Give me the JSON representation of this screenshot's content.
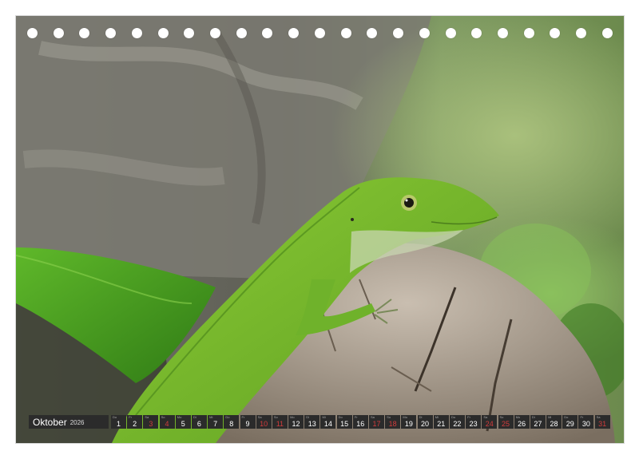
{
  "calendar": {
    "month": "Oktober",
    "year": "2026",
    "days": [
      {
        "n": "1",
        "wd": "Do",
        "weekend": false
      },
      {
        "n": "2",
        "wd": "Fr",
        "weekend": false
      },
      {
        "n": "3",
        "wd": "Sa",
        "weekend": true
      },
      {
        "n": "4",
        "wd": "So",
        "weekend": true
      },
      {
        "n": "5",
        "wd": "Mo",
        "weekend": false
      },
      {
        "n": "6",
        "wd": "Di",
        "weekend": false
      },
      {
        "n": "7",
        "wd": "Mi",
        "weekend": false
      },
      {
        "n": "8",
        "wd": "Do",
        "weekend": false
      },
      {
        "n": "9",
        "wd": "Fr",
        "weekend": false
      },
      {
        "n": "10",
        "wd": "Sa",
        "weekend": true
      },
      {
        "n": "11",
        "wd": "So",
        "weekend": true
      },
      {
        "n": "12",
        "wd": "Mo",
        "weekend": false
      },
      {
        "n": "13",
        "wd": "Di",
        "weekend": false
      },
      {
        "n": "14",
        "wd": "Mi",
        "weekend": false
      },
      {
        "n": "15",
        "wd": "Do",
        "weekend": false
      },
      {
        "n": "16",
        "wd": "Fr",
        "weekend": false
      },
      {
        "n": "17",
        "wd": "Sa",
        "weekend": true
      },
      {
        "n": "18",
        "wd": "So",
        "weekend": true
      },
      {
        "n": "19",
        "wd": "Mo",
        "weekend": false
      },
      {
        "n": "20",
        "wd": "Di",
        "weekend": false
      },
      {
        "n": "21",
        "wd": "Mi",
        "weekend": false
      },
      {
        "n": "22",
        "wd": "Do",
        "weekend": false
      },
      {
        "n": "23",
        "wd": "Fr",
        "weekend": false
      },
      {
        "n": "24",
        "wd": "Sa",
        "weekend": true
      },
      {
        "n": "25",
        "wd": "So",
        "weekend": true
      },
      {
        "n": "26",
        "wd": "Mo",
        "weekend": false
      },
      {
        "n": "27",
        "wd": "Di",
        "weekend": false
      },
      {
        "n": "28",
        "wd": "Mi",
        "weekend": false
      },
      {
        "n": "29",
        "wd": "Do",
        "weekend": false
      },
      {
        "n": "30",
        "wd": "Fr",
        "weekend": false
      },
      {
        "n": "31",
        "wd": "Sa",
        "weekend": true
      }
    ]
  },
  "binding_hole_count": 23,
  "colors": {
    "lizard_green": "#74b92c",
    "leaf_green": "#4da51e",
    "bark": "#a89a86",
    "weekend_red": "#d23c3c",
    "bar_bg": "#2b2b2b"
  }
}
